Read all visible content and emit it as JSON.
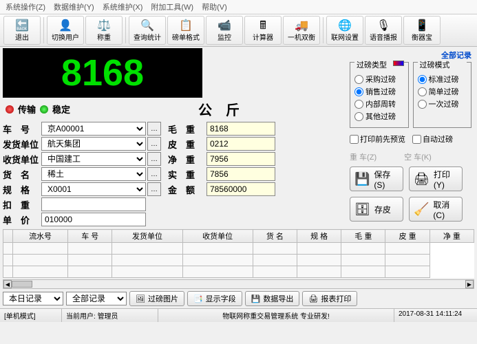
{
  "menubar": [
    "系统操作(Z)",
    "数据维护(Y)",
    "系统维护(X)",
    "附加工具(W)",
    "帮助(V)"
  ],
  "toolbar": [
    {
      "label": "退出",
      "icon": "🔙"
    },
    {
      "label": "切换用户",
      "icon": "👤"
    },
    {
      "label": "称重",
      "icon": "⚖️"
    },
    {
      "label": "查询统计",
      "icon": "🔍"
    },
    {
      "label": "磅单格式",
      "icon": "📋"
    },
    {
      "label": "监控",
      "icon": "📹"
    },
    {
      "label": "计算器",
      "icon": "🖩"
    },
    {
      "label": "一机双衡",
      "icon": "🚚"
    },
    {
      "label": "联网设置",
      "icon": "🌐"
    },
    {
      "label": "语音播报",
      "icon": "🎙"
    },
    {
      "label": "衡器宝",
      "icon": "📱"
    }
  ],
  "lcd_value": "8168",
  "status": {
    "transmit": "传输",
    "stable": "稳定"
  },
  "unit": "公　斤",
  "top_link": "全部记录",
  "left_form": [
    {
      "label": "车　号",
      "value": "京A00001",
      "type": "select",
      "browse": true
    },
    {
      "label": "发货单位",
      "value": "航天集团",
      "type": "select",
      "browse": true
    },
    {
      "label": "收货单位",
      "value": "中国建工",
      "type": "select",
      "browse": true
    },
    {
      "label": "货　名",
      "value": "稀土",
      "type": "select",
      "browse": true
    },
    {
      "label": "规　格",
      "value": "X0001",
      "type": "select",
      "browse": true
    },
    {
      "label": "扣　重",
      "value": "",
      "type": "text",
      "browse": false
    },
    {
      "label": "单　价",
      "value": "010000",
      "type": "text",
      "browse": false
    }
  ],
  "right_form": [
    {
      "label": "毛　重",
      "value": "8168"
    },
    {
      "label": "皮　重",
      "value": "0212"
    },
    {
      "label": "净　重",
      "value": "7956"
    },
    {
      "label": "实　重",
      "value": "7856"
    },
    {
      "label": "金　额",
      "value": "78560000"
    }
  ],
  "filter_type": {
    "title": "过磅类型",
    "options": [
      "采购过磅",
      "销售过磅",
      "内部周转",
      "其他过磅"
    ],
    "selected": 1
  },
  "weigh_mode": {
    "title": "过磅模式",
    "options": [
      "标准过磅",
      "简单过磅",
      "一次过磅"
    ],
    "selected": 0
  },
  "checkboxes": {
    "preview": "打印前先预览",
    "auto": "自动过磅"
  },
  "side_buttons": {
    "heavy": "重 车(Z)",
    "empty": "空 车(K)",
    "save": "保存(S)",
    "print": "打印(Y)",
    "tare": "存皮",
    "cancel": "取消(C)"
  },
  "table_headers": [
    "流水号",
    "车 号",
    "发货单位",
    "收货单位",
    "货  名",
    "规 格",
    "毛 重",
    "皮 重",
    "净 重"
  ],
  "bottom_bar": {
    "selects": [
      "本日记录",
      "全部记录"
    ],
    "buttons": [
      {
        "label": "过磅图片",
        "icon": "🖼"
      },
      {
        "label": "显示字段",
        "icon": "📑"
      },
      {
        "label": "数据导出",
        "icon": "💾"
      },
      {
        "label": "报表打印",
        "icon": "🖨"
      }
    ]
  },
  "status_bar": {
    "mode": "[单机模式]",
    "user_label": "当前用户:",
    "user": "管理员",
    "system": "物联网称重交易管理系统 专业研发!",
    "datetime": "2017-08-31 14:11:24"
  }
}
